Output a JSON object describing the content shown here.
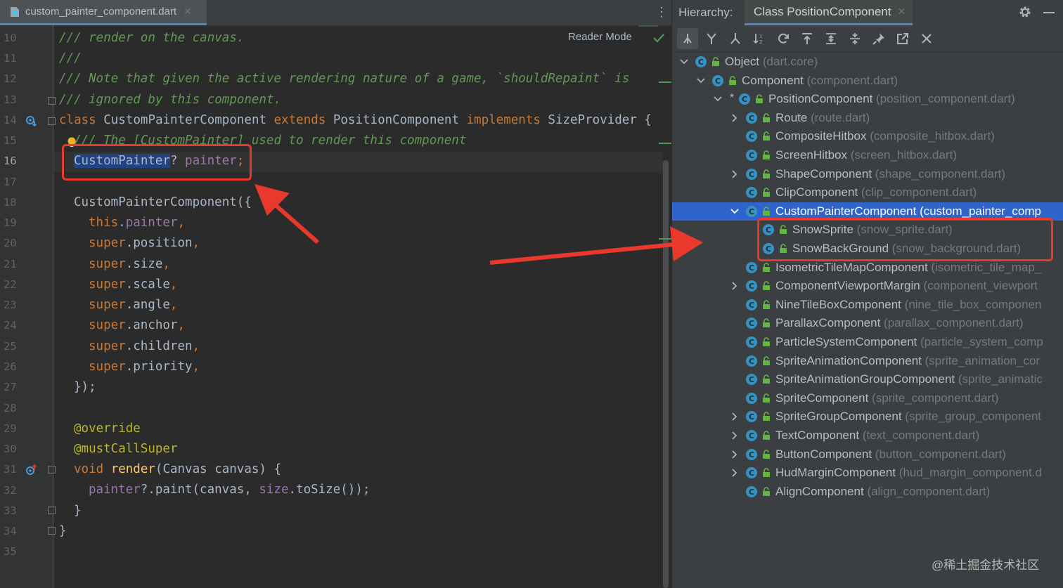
{
  "editor": {
    "file_tab": {
      "name": "custom_painter_component.dart",
      "close": "✕"
    },
    "more": "⋮",
    "reader_mode": "Reader Mode",
    "line_numbers": [
      "10",
      "11",
      "12",
      "13",
      "14",
      "15",
      "16",
      "17",
      "18",
      "19",
      "20",
      "21",
      "22",
      "23",
      "24",
      "25",
      "26",
      "27",
      "28",
      "29",
      "30",
      "31",
      "32",
      "33",
      "34",
      "35"
    ],
    "current_line": "16",
    "code": {
      "l10": "/// render on the canvas.",
      "l11": "///",
      "l12": "/// Note that given the active rendering nature of a game, `shouldRepaint` is",
      "l13": "/// ignored by this component.",
      "l14_a": "class",
      "l14_b": " CustomPainterComponent ",
      "l14_c": "extends",
      "l14_d": " PositionComponent ",
      "l14_e": "implements",
      "l14_f": " SizeProvider {",
      "l15": "/// The [CustomPainter] used to render this component",
      "l16_a": "CustomPainter",
      "l16_b": "? ",
      "l16_c": "painter",
      "l16_d": ";",
      "l18": "CustomPainterComponent({",
      "l19_a": "this",
      "l19_b": ".",
      "l19_c": "painter",
      "l19_d": ",",
      "super_kw": "super",
      "l20": "position",
      "l21": "size",
      "l22": "scale",
      "l23": "angle",
      "l24": "anchor",
      "l25": "children",
      "l26": "priority",
      "l27": "});",
      "l29": "@override",
      "l30": "@mustCallSuper",
      "l31_a": "void ",
      "l31_b": "render",
      "l31_c": "(Canvas canvas) {",
      "l32_a": "painter",
      "l32_b": "?.paint(canvas, ",
      "l32_c": "size",
      "l32_d": ".toSize());",
      "l33": "}",
      "l34": "}"
    }
  },
  "hierarchy": {
    "label": "Hierarchy:",
    "tab": "Class PositionComponent",
    "tab_close": "✕",
    "toolbar_icons": [
      "subtypes-hierarchy-icon",
      "supertypes-hierarchy-icon",
      "class-hierarchy-icon",
      "sort-alphabetically-icon",
      "refresh-icon",
      "scope-up-icon",
      "expand-all-icon",
      "collapse-all-icon",
      "pin-icon",
      "export-icon",
      "close-icon"
    ],
    "tree": [
      {
        "name": "Object",
        "file": "(dart.core)",
        "arrow": "down"
      },
      {
        "name": "Component",
        "file": "(component.dart)",
        "arrow": "down"
      },
      {
        "name": "PositionComponent",
        "file": "(position_component.dart)",
        "arrow": "down",
        "star": "*"
      },
      {
        "name": "Route",
        "file": "(route.dart)",
        "arrow": "right"
      },
      {
        "name": "CompositeHitbox",
        "file": "(composite_hitbox.dart)",
        "arrow": ""
      },
      {
        "name": "ScreenHitbox",
        "file": "(screen_hitbox.dart)",
        "arrow": ""
      },
      {
        "name": "ShapeComponent",
        "file": "(shape_component.dart)",
        "arrow": "right"
      },
      {
        "name": "ClipComponent",
        "file": "(clip_component.dart)",
        "arrow": ""
      },
      {
        "name": "CustomPainterComponent",
        "file": "(custom_painter_comp",
        "arrow": "down",
        "selected": true
      },
      {
        "name": "SnowSprite",
        "file": "(snow_sprite.dart)",
        "arrow": ""
      },
      {
        "name": "SnowBackGround",
        "file": "(snow_background.dart)",
        "arrow": ""
      },
      {
        "name": "IsometricTileMapComponent",
        "file": "(isometric_tile_map_",
        "arrow": ""
      },
      {
        "name": "ComponentViewportMargin",
        "file": "(component_viewport",
        "arrow": "right"
      },
      {
        "name": "NineTileBoxComponent",
        "file": "(nine_tile_box_componen",
        "arrow": ""
      },
      {
        "name": "ParallaxComponent",
        "file": "(parallax_component.dart)",
        "arrow": ""
      },
      {
        "name": "ParticleSystemComponent",
        "file": "(particle_system_comp",
        "arrow": ""
      },
      {
        "name": "SpriteAnimationComponent",
        "file": "(sprite_animation_cor",
        "arrow": ""
      },
      {
        "name": "SpriteAnimationGroupComponent",
        "file": "(sprite_animatic",
        "arrow": ""
      },
      {
        "name": "SpriteComponent",
        "file": "(sprite_component.dart)",
        "arrow": ""
      },
      {
        "name": "SpriteGroupComponent",
        "file": "(sprite_group_component",
        "arrow": "right"
      },
      {
        "name": "TextComponent",
        "file": "(text_component.dart)",
        "arrow": "right"
      },
      {
        "name": "ButtonComponent",
        "file": "(button_component.dart)",
        "arrow": "right"
      },
      {
        "name": "HudMarginComponent",
        "file": "(hud_margin_component.d",
        "arrow": "right"
      },
      {
        "name": "AlignComponent",
        "file": "(align_component.dart)",
        "arrow": ""
      }
    ]
  },
  "watermark": "@稀土掘金技术社区",
  "colors": {
    "accent": "#4a88c7",
    "selection": "#2f65ca",
    "annotation_red": "#e8392c"
  }
}
